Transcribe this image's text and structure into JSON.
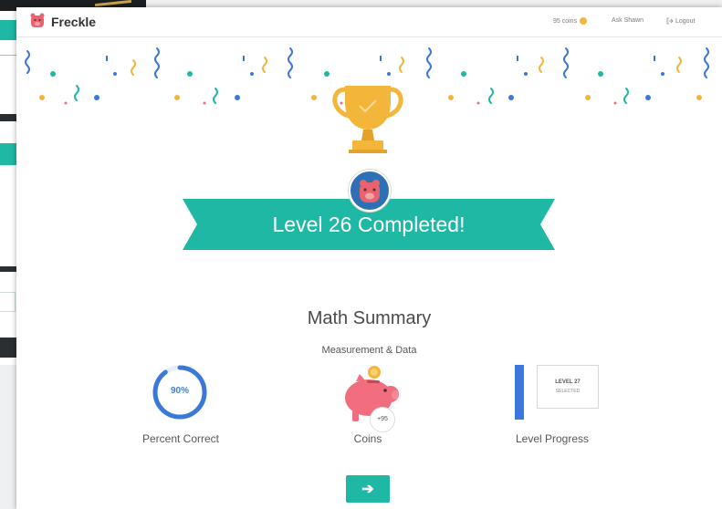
{
  "app": {
    "name": "Freckle"
  },
  "header": {
    "coins": "95 coins",
    "student_link": "Ask Shawn",
    "logout_label": "Logout"
  },
  "celebration": {
    "banner_text": "Level 26 Completed!"
  },
  "summary": {
    "title": "Math Summary",
    "subtitle": "Measurement & Data",
    "percent_correct": {
      "value": "90%",
      "fraction": 0.9,
      "label": "Percent Correct"
    },
    "coins": {
      "earned": "+95",
      "label": "Coins"
    },
    "level_progress": {
      "level": "LEVEL 27",
      "status": "SELECTED",
      "label": "Level Progress"
    }
  },
  "next_button": {
    "label": "➔"
  },
  "colors": {
    "teal": "#1fb8a4",
    "gold": "#f3b63a",
    "blue": "#3b78d9",
    "pink": "#f26d7d"
  },
  "icons": [
    "freckle-logo-icon",
    "coin-icon",
    "logout-icon",
    "trophy-icon",
    "avatar-pig-icon",
    "piggy-bank-icon",
    "arrow-right-icon"
  ]
}
